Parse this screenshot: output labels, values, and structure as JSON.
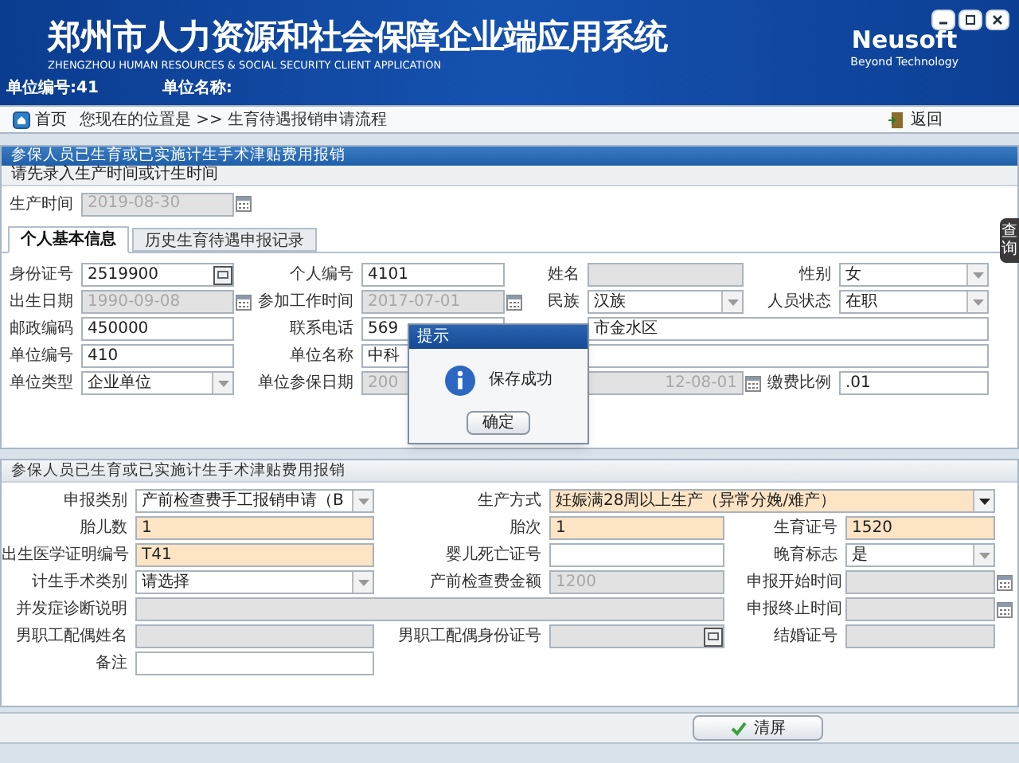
{
  "header": {
    "title": "郑州市人力资源和社会保障企业端应用系统",
    "subtitle": "ZHENGZHOU HUMAN RESOURCES & SOCIAL SECURITY CLIENT APPLICATION",
    "logo": "Neusoft",
    "tagline": "Beyond Technology",
    "unit_no": "单位编号:41",
    "unit_name": "单位名称:"
  },
  "nav": {
    "home": "首页",
    "breadcrumb": "您现在的位置是 >> 生育待遇报销申请流程",
    "back": "返回"
  },
  "section1": {
    "title": "参保人员已生育或已实施计生手术津贴费用报销",
    "hint": "请先录入生产时间或计生时间",
    "birth_time": {
      "label": "生产时间",
      "value": "2019-08-30",
      "kind": "date",
      "disabled": true
    }
  },
  "tabs": [
    {
      "label": "个人基本信息",
      "selected": true
    },
    {
      "label": "历史生育待遇申报记录",
      "selected": false
    }
  ],
  "person_rows": [
    [
      {
        "label": "身份证号",
        "value": "2519900",
        "kind": "id",
        "disabled": false
      },
      {
        "label": "个人编号",
        "value": "4101",
        "kind": "text",
        "disabled": false
      },
      {
        "label": "姓名",
        "kind": "text",
        "disabled": true
      },
      {
        "label": "性别",
        "value": "女",
        "kind": "select",
        "disabled": false
      }
    ],
    [
      {
        "label": "出生日期",
        "value": "1990-09-08",
        "kind": "date",
        "disabled": true
      },
      {
        "label": "参加工作时间",
        "value": "2017-07-01",
        "kind": "date",
        "disabled": true
      },
      {
        "label": "民族",
        "value": "汉族",
        "kind": "select",
        "disabled": false
      },
      {
        "label": "人员状态",
        "value": "在职",
        "kind": "select",
        "disabled": false
      }
    ],
    [
      {
        "label": "邮政编码",
        "value": "450000",
        "kind": "text",
        "disabled": false
      },
      {
        "label": "联系电话",
        "value": "569",
        "kind": "text",
        "disabled": false
      },
      {
        "value": "市金水区",
        "kind": "text",
        "disabled": false,
        "wide": true
      }
    ],
    [
      {
        "label": "单位编号",
        "value": "410",
        "kind": "text",
        "disabled": false
      },
      {
        "label": "单位名称",
        "value": "中科",
        "kind": "text",
        "disabled": false,
        "wide": true
      }
    ],
    [
      {
        "label": "单位类型",
        "value": "企业单位",
        "kind": "select",
        "disabled": false
      },
      {
        "label": "单位参保日期",
        "value_parts": [
          "200",
          "12-08-01"
        ],
        "kind": "date",
        "disabled": true,
        "wide": true
      },
      {
        "label": "缴费比例",
        "value": ".01",
        "kind": "text",
        "disabled": false
      }
    ]
  ],
  "dialog": {
    "title": "提示",
    "message": "保存成功",
    "button": "确定"
  },
  "section2": {
    "title": "参保人员已生育或已实施计生手术津贴费用报销",
    "rows": [
      [
        {
          "label": "申报类别",
          "value": "产前检查费手工报销申请（B",
          "kind": "select",
          "required": false,
          "disabled": false
        },
        {
          "label": "生产方式",
          "value": "妊娠满28周以上生产（异常分娩/难产）",
          "kind": "select",
          "required": true,
          "disabled": false,
          "wide": true
        }
      ],
      [
        {
          "label": "胎儿数",
          "value": "1",
          "kind": "text",
          "required": true,
          "disabled": false
        },
        {
          "label": "胎次",
          "value": "1",
          "kind": "text",
          "required": true,
          "disabled": false
        },
        {
          "label": "生育证号",
          "value": "1520",
          "kind": "text",
          "required": true,
          "disabled": false
        }
      ],
      [
        {
          "label": "出生医学证明编号",
          "value": "T41",
          "kind": "text",
          "required": true,
          "disabled": false
        },
        {
          "label": "婴儿死亡证号",
          "kind": "text",
          "required": false,
          "disabled": false
        },
        {
          "label": "晚育标志",
          "value": "是",
          "kind": "select",
          "required": false,
          "disabled": false
        }
      ],
      [
        {
          "label": "计生手术类别",
          "value": "请选择",
          "kind": "select",
          "required": false,
          "disabled": false
        },
        {
          "label": "产前检查费金额",
          "value": "1200",
          "kind": "text",
          "required": false,
          "disabled": true
        },
        {
          "label": "申报开始时间",
          "kind": "date",
          "required": false,
          "disabled": true
        }
      ],
      [
        {
          "label": "并发症诊断说明",
          "kind": "text",
          "required": false,
          "disabled": true,
          "wide": true
        },
        {
          "label": "申报终止时间",
          "kind": "date",
          "required": false,
          "disabled": true
        }
      ],
      [
        {
          "label": "男职工配偶姓名",
          "kind": "text",
          "required": false,
          "disabled": true
        },
        {
          "label": "男职工配偶身份证号",
          "kind": "id",
          "required": false,
          "disabled": true
        },
        {
          "label": "结婚证号",
          "kind": "text",
          "required": false,
          "disabled": true
        }
      ],
      [
        {
          "label": "备注",
          "kind": "text",
          "required": false,
          "disabled": false
        }
      ]
    ]
  },
  "footer": {
    "button": "清屏"
  },
  "side_tab": "查询"
}
